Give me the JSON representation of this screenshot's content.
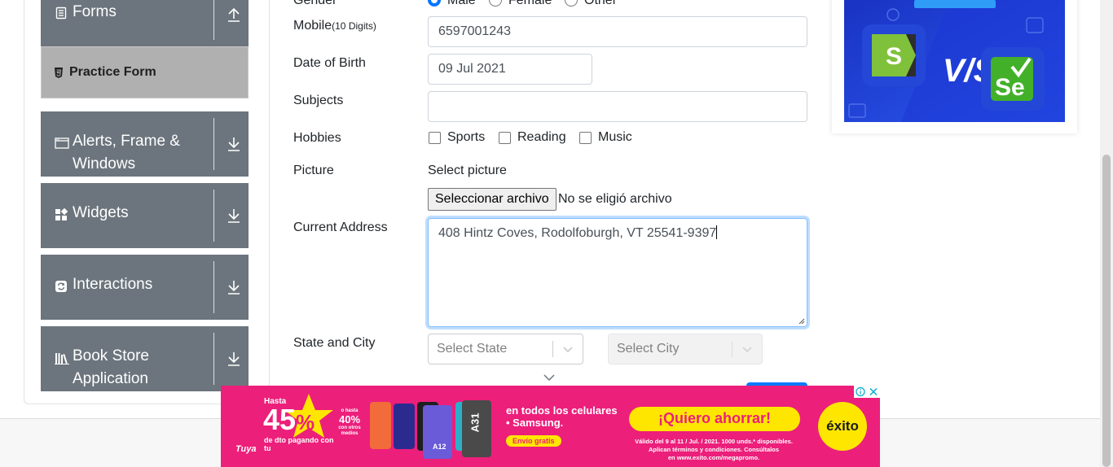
{
  "sidebar": {
    "groups": [
      {
        "title": "Forms",
        "icon": "form-icon",
        "arrow": "arrow-up-icon"
      },
      {
        "title": "Alerts, Frame & Windows",
        "icon": "window-icon",
        "arrow": "arrow-down-icon"
      },
      {
        "title": "Widgets",
        "icon": "widgets-icon",
        "arrow": "arrow-down-icon"
      },
      {
        "title": "Interactions",
        "icon": "interactions-icon",
        "arrow": "arrow-down-icon"
      },
      {
        "title": "Book Store Application",
        "icon": "books-icon",
        "arrow": "arrow-down-icon"
      }
    ],
    "active_item": {
      "label": "Practice Form",
      "icon": "html5-icon"
    }
  },
  "form": {
    "gender": {
      "label": "Gender",
      "options": [
        {
          "label": "Male",
          "checked": true
        },
        {
          "label": "Female",
          "checked": false
        },
        {
          "label": "Other",
          "checked": false
        }
      ]
    },
    "mobile": {
      "label": "Mobile",
      "hint": "(10 Digits)",
      "value": "6597001243"
    },
    "dob": {
      "label": "Date of Birth",
      "value": "09 Jul 2021"
    },
    "subjects": {
      "label": "Subjects",
      "value": ""
    },
    "hobbies": {
      "label": "Hobbies",
      "options": [
        {
          "label": "Sports",
          "checked": false
        },
        {
          "label": "Reading",
          "checked": false
        },
        {
          "label": "Music",
          "checked": false
        }
      ]
    },
    "picture": {
      "label": "Picture",
      "select_text": "Select picture",
      "button_label": "Seleccionar archivo",
      "file_status": "No se eligió archivo"
    },
    "address": {
      "label": "Current Address",
      "value": "408 Hintz Coves, Rodolfoburgh, VT 25541-9397"
    },
    "state_city": {
      "label": "State and City",
      "state_placeholder": "Select State",
      "city_placeholder": "Select City"
    }
  },
  "ads": {
    "bottom": {
      "hasta": "Hasta",
      "percent": "45",
      "percent_sign": "%",
      "badge_pct": "40%",
      "badge_top": "o hasta",
      "badge_bottom": "con otros medios",
      "dto_text": "de dto pagando con tu",
      "phone_models": [
        "A12",
        "A31"
      ],
      "headline_1": "en todos los celulares",
      "headline_2": "• Samsung.",
      "shipping": "Envío gratis",
      "cta": "¡Quiero ahorrar!",
      "legal_1": "Válido del 9 al 11 / Jul. / 2021. 1000 unds.* disponibles.",
      "legal_2": "Aplican términos y condiciones. Consúltalos",
      "legal_3": "en www.exito.com/megapromo.",
      "brand": "éxito",
      "tuya": "Tuya"
    },
    "right": {
      "vs": "V/S"
    },
    "colors": {
      "pink": "#ec1f7b",
      "yellow": "#ffe600",
      "blue": "#1f3fd1"
    }
  }
}
